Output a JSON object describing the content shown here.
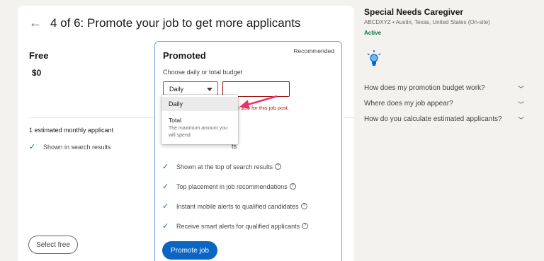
{
  "header": {
    "back_icon": "arrow-left-icon",
    "title": "4 of 6: Promote your job to get more applicants"
  },
  "free": {
    "title": "Free",
    "price": "$0",
    "estimate": "1 estimated monthly applicant",
    "features": [
      "Shown in search results"
    ],
    "button": "Select free"
  },
  "promoted": {
    "title": "Promoted",
    "badge": "Recommended",
    "budget_label": "Choose daily or total budget",
    "budget_selected": "Daily",
    "budget_value": "",
    "error_text": "re than $99 for this job post.",
    "partial_feature": "ts",
    "features": [
      "Shown at the top of search results",
      "Top placement in job recommendations",
      "Instant mobile alerts to qualified candidates",
      "Receive smart alerts for qualified applicants"
    ],
    "button": "Promote job"
  },
  "dropdown": {
    "options": [
      {
        "label": "Daily"
      },
      {
        "label": "Total",
        "description": "The maximum amount you will spend"
      }
    ]
  },
  "sidebar": {
    "job_title": "Special Needs Caregiver",
    "subtitle": "ABCDXYZ • Austin, Texas, United States (On-site)",
    "status": "Active",
    "icon": "lightbulb-icon",
    "faqs": [
      "How does my promotion budget work?",
      "Where does my job appear?",
      "How do you calculate estimated applicants?"
    ]
  },
  "colors": {
    "accent": "#0a66c2",
    "error": "#cc1016",
    "active": "#057642",
    "annotation_arrow": "#e8336b"
  }
}
